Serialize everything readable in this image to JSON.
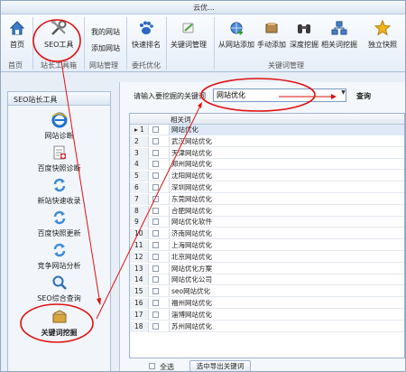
{
  "window": {
    "title": "云优..."
  },
  "ribbon": {
    "buttons": [
      {
        "label": "首页",
        "icon": "home-icon"
      },
      {
        "label": "SEO工具",
        "icon": "tools-icon"
      },
      {
        "label": "快速排名",
        "icon": "paw-icon"
      },
      {
        "label": "关键词管理",
        "icon": "keyword-icon"
      },
      {
        "label": "从网站添加",
        "icon": "web-add-icon"
      },
      {
        "label": "手动添加",
        "icon": "hand-add-icon"
      },
      {
        "label": "深度挖掘",
        "icon": "binoculars-icon"
      },
      {
        "label": "相关词挖掘",
        "icon": "network-icon"
      },
      {
        "label": "独立快照",
        "icon": "star-icon"
      }
    ],
    "small_buttons": [
      "我的网站",
      "添加网站"
    ],
    "groups": [
      "首页",
      "站长工具箱",
      "网站管理",
      "委托优化",
      "关键词管理"
    ]
  },
  "sidebar": {
    "title": "SEO站长工具",
    "items": [
      {
        "label": "网站诊断",
        "icon": "ie-icon"
      },
      {
        "label": "百度快照诊断",
        "icon": "doc-medical-icon"
      },
      {
        "label": "新站快速收录",
        "icon": "refresh-icon"
      },
      {
        "label": "百度快照更新",
        "icon": "refresh-icon"
      },
      {
        "label": "竞争网站分析",
        "icon": "refresh-icon"
      },
      {
        "label": "SEO综合查询",
        "icon": "magnifier-icon"
      },
      {
        "label": "关键词挖掘",
        "icon": "mining-icon"
      }
    ]
  },
  "search": {
    "label": "请输入要挖掘的关键词",
    "value": "网站优化",
    "button": "查询"
  },
  "grid": {
    "column": "相关词",
    "rows": [
      {
        "no": "1",
        "kw": "网站优化"
      },
      {
        "no": "2",
        "kw": "武汉网站优化"
      },
      {
        "no": "3",
        "kw": "天津网站优化"
      },
      {
        "no": "4",
        "kw": "郑州网站优化"
      },
      {
        "no": "5",
        "kw": "沈阳网站优化"
      },
      {
        "no": "6",
        "kw": "深圳网站优化"
      },
      {
        "no": "7",
        "kw": "东莞网站优化"
      },
      {
        "no": "8",
        "kw": "合肥网站优化"
      },
      {
        "no": "9",
        "kw": "网站优化软件"
      },
      {
        "no": "10",
        "kw": "济南网站优化"
      },
      {
        "no": "11",
        "kw": "上海网站优化"
      },
      {
        "no": "12",
        "kw": "北京网站优化"
      },
      {
        "no": "13",
        "kw": "网站优化方案"
      },
      {
        "no": "14",
        "kw": "网站优化公司"
      },
      {
        "no": "15",
        "kw": "seo网站优化"
      },
      {
        "no": "16",
        "kw": "福州网站优化"
      },
      {
        "no": "17",
        "kw": "淄博网站优化"
      },
      {
        "no": "18",
        "kw": "苏州网站优化"
      }
    ]
  },
  "footer": {
    "select_all": "全选",
    "export": "选中导出关键词"
  },
  "colors": {
    "annotation": "#e01010",
    "accent": "#2b6cb8"
  }
}
